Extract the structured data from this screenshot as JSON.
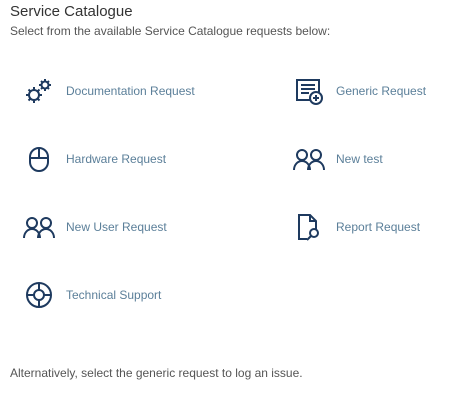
{
  "header": {
    "title": "Service Catalogue",
    "subtitle": "Select from the available Service Catalogue requests below:"
  },
  "items": [
    {
      "label": "Documentation Request",
      "icon": "gears-icon"
    },
    {
      "label": "Generic Request",
      "icon": "list-add-icon"
    },
    {
      "label": "Hardware Request",
      "icon": "mouse-icon"
    },
    {
      "label": "New test",
      "icon": "users-icon"
    },
    {
      "label": "New User Request",
      "icon": "users-icon"
    },
    {
      "label": "Report Request",
      "icon": "document-search-icon"
    },
    {
      "label": "Technical Support",
      "icon": "lifebuoy-icon"
    }
  ],
  "footer": {
    "text": "Alternatively, select the generic request to log an issue."
  },
  "colors": {
    "icon": "#1e3a5f",
    "label": "#5b7f99",
    "text": "#333333"
  }
}
